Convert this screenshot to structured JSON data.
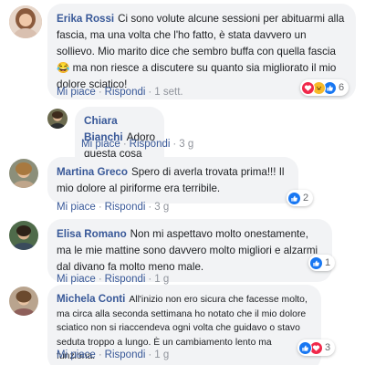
{
  "colors": {
    "link": "#385898",
    "bubble": "#f2f3f5",
    "meta": "#90949c",
    "like": "#1877f2",
    "love": "#f0284a",
    "haha": "#f7b928"
  },
  "comments": [
    {
      "author": "Erika Rossi",
      "text": "Ci sono volute alcune sessioni per abituarmi alla fascia, ma una volta che l'ho fatto, è stata davvero un sollievo. Mio marito dice che sembro buffa con quella fascia 😂 ma non riesce a discutere su quanto sia migliorato il mio dolore sciatico!",
      "like_label": "Mi piace",
      "reply_label": "Rispondi",
      "time": "1 sett.",
      "reactions": [
        "love-icon",
        "haha-icon",
        "like-icon"
      ],
      "reaction_count": "6"
    },
    {
      "author": "Chiara Bianchi",
      "text": "Adoro questa cosa 😂",
      "like_label": "Mi piace",
      "reply_label": "Rispondi",
      "time": "3 g"
    },
    {
      "author": "Martina Greco",
      "text": "Spero di averla trovata prima!!! Il mio dolore al piriforme era terribile.",
      "like_label": "Mi piace",
      "reply_label": "Rispondi",
      "time": "3 g",
      "reactions": [
        "like-icon"
      ],
      "reaction_count": "2"
    },
    {
      "author": "Elisa Romano",
      "text": "Non mi aspettavo molto onestamente, ma le mie mattine sono davvero molto migliori e alzarmi dal divano fa molto meno male.",
      "like_label": "Mi piace",
      "reply_label": "Rispondi",
      "time": "1 g",
      "reactions": [
        "like-icon"
      ],
      "reaction_count": "1"
    },
    {
      "author": "Michela Conti",
      "text": "All'inizio non ero sicura che facesse molto, ma circa alla seconda settimana ho notato che il mio dolore sciatico non si riaccendeva ogni volta che guidavo o stavo seduta troppo a lungo. È un cambiamento lento ma funziona.",
      "like_label": "Mi piace",
      "reply_label": "Rispondi",
      "time": "1 g",
      "reactions": [
        "like-icon",
        "love-icon"
      ],
      "reaction_count": "3"
    }
  ]
}
